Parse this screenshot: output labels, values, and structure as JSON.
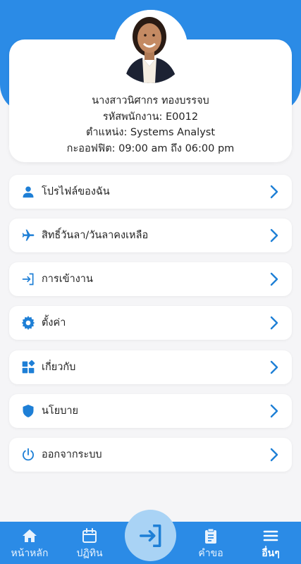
{
  "profile": {
    "name": "นางสาวนิศากร ทองบรรจบ",
    "employee_id": "รหัสพนักงาน: E0012",
    "position": "ตำแหน่ง: Systems Analyst",
    "shift": "กะออฟฟิต: 09:00 am ถึง 06:00 pm"
  },
  "menu": {
    "items": [
      {
        "label": "โปรไฟล์ของฉัน",
        "icon": "person-icon"
      },
      {
        "label": "สิทธิ์วันลา/วันลาคงเหลือ",
        "icon": "airplane-icon"
      },
      {
        "label": "การเข้างาน",
        "icon": "login-icon"
      },
      {
        "label": "ตั้งค่า",
        "icon": "gear-icon"
      },
      {
        "label": "เกี่ยวกับ",
        "icon": "widgets-icon"
      },
      {
        "label": "นโยบาย",
        "icon": "shield-icon"
      },
      {
        "label": "ออกจากระบบ",
        "icon": "power-icon"
      }
    ]
  },
  "bottom_nav": {
    "home": "หน้าหลัก",
    "calendar": "ปฏิทิน",
    "request": "คำขอ",
    "more": "อื่นๆ"
  },
  "colors": {
    "primary": "#2b8be6",
    "icon": "#1e7fd6",
    "center_button": "#a9d3f5"
  }
}
